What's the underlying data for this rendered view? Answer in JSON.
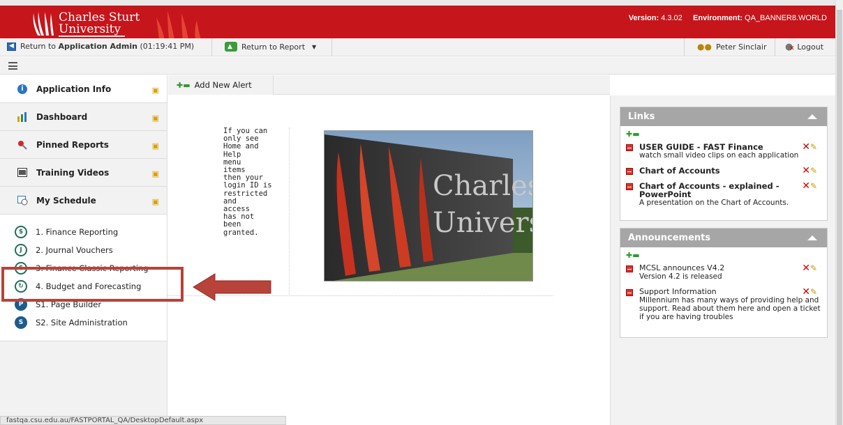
{
  "header": {
    "logo_line1": "Charles Sturt",
    "logo_line2": "University",
    "version_label": "Version:",
    "version_value": "4.3.02",
    "environment_label": "Environment:",
    "environment_value": "QA_BANNER8.WORLD"
  },
  "toolbar": {
    "return_prefix": "Return to ",
    "return_app": "Application Admin",
    "return_time": " (01:19:41 PM)",
    "return_report": "Return to Report",
    "user_name": "Peter Sinclair",
    "logout": "Logout"
  },
  "sidebar": {
    "items": [
      {
        "label": "Application Info",
        "icon": "info-icon"
      },
      {
        "label": "Dashboard",
        "icon": "bar-chart-icon"
      },
      {
        "label": "Pinned Reports",
        "icon": "pin-icon"
      },
      {
        "label": "Training Videos",
        "icon": "film-icon"
      },
      {
        "label": "My Schedule",
        "icon": "calendar-icon"
      }
    ],
    "schedule": [
      {
        "label": "1. Finance Reporting",
        "glyph": "$"
      },
      {
        "label": "2. Journal Vouchers",
        "glyph": "J"
      },
      {
        "label": "3. Finance Classic Reporting",
        "glyph": "$"
      },
      {
        "label": "4. Budget and Forecasting",
        "glyph": "↻"
      },
      {
        "label": "S1. Page Builder",
        "glyph": "P"
      },
      {
        "label": "S2. Site Administration",
        "glyph": "S"
      }
    ]
  },
  "main": {
    "add_alert": "Add New Alert",
    "message": "If you can\nonly see\nHome and\nHelp\nmenu\nitems\nthen your\nlogin ID is\nrestricted\nand\naccess\nhas not\nbeen\ngranted.",
    "photo_text1": "Charles Sturt",
    "photo_text2": "University"
  },
  "links": {
    "title": "Links",
    "items": [
      {
        "title": "USER GUIDE - FAST Finance",
        "desc": "watch small video clips on each application"
      },
      {
        "title": "Chart of Accounts",
        "desc": ""
      },
      {
        "title": "Chart of Accounts - explained - PowerPoint",
        "desc": "A presentation on the Chart of Accounts."
      }
    ]
  },
  "announcements": {
    "title": "Announcements",
    "items": [
      {
        "title": "MCSL announces V4.2",
        "desc": "Version 4.2 is released"
      },
      {
        "title": "Support Information",
        "desc": "Millennium has many ways of providing help and support. Read about them here and open a ticket if you are having troubles"
      }
    ]
  },
  "status_bar": "fastqa.csu.edu.au/FASTPORTAL_QA/DesktopDefault.aspx",
  "colors": {
    "brand": "#c6151b",
    "highlight": "#b7433a"
  }
}
